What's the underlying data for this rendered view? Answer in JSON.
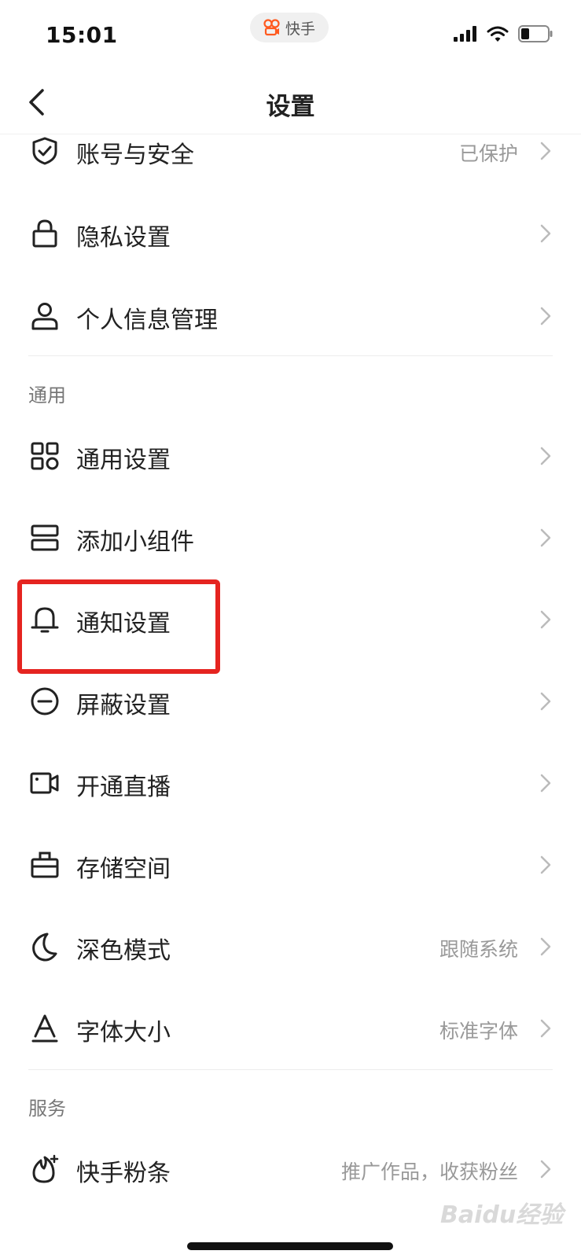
{
  "status_bar": {
    "time": "15:01",
    "app_pill_label": "快手",
    "icons": [
      "cellular-signal-icon",
      "wifi-icon",
      "battery-icon"
    ]
  },
  "nav": {
    "back_icon": "chevron-left-icon",
    "title": "设置"
  },
  "account_section": {
    "items": [
      {
        "icon": "shield-check-icon",
        "label": "账号与安全",
        "value": "已保护"
      },
      {
        "icon": "lock-icon",
        "label": "隐私设置",
        "value": ""
      },
      {
        "icon": "person-icon",
        "label": "个人信息管理",
        "value": ""
      }
    ]
  },
  "general_section": {
    "header": "通用",
    "items": [
      {
        "icon": "grid-apps-icon",
        "label": "通用设置",
        "value": ""
      },
      {
        "icon": "widget-icon",
        "label": "添加小组件",
        "value": ""
      },
      {
        "icon": "bell-icon",
        "label": "通知设置",
        "value": "",
        "highlighted": true
      },
      {
        "icon": "block-minus-icon",
        "label": "屏蔽设置",
        "value": ""
      },
      {
        "icon": "video-camera-icon",
        "label": "开通直播",
        "value": ""
      },
      {
        "icon": "storage-box-icon",
        "label": "存储空间",
        "value": ""
      },
      {
        "icon": "moon-icon",
        "label": "深色模式",
        "value": "跟随系统"
      },
      {
        "icon": "font-size-icon",
        "label": "字体大小",
        "value": "标准字体"
      }
    ]
  },
  "service_section": {
    "header": "服务",
    "items": [
      {
        "icon": "fan-flame-icon",
        "label": "快手粉条",
        "value": "推广作品，收获粉丝"
      }
    ]
  },
  "highlight_color": "#e52420",
  "watermark_text": "Baidu经验"
}
